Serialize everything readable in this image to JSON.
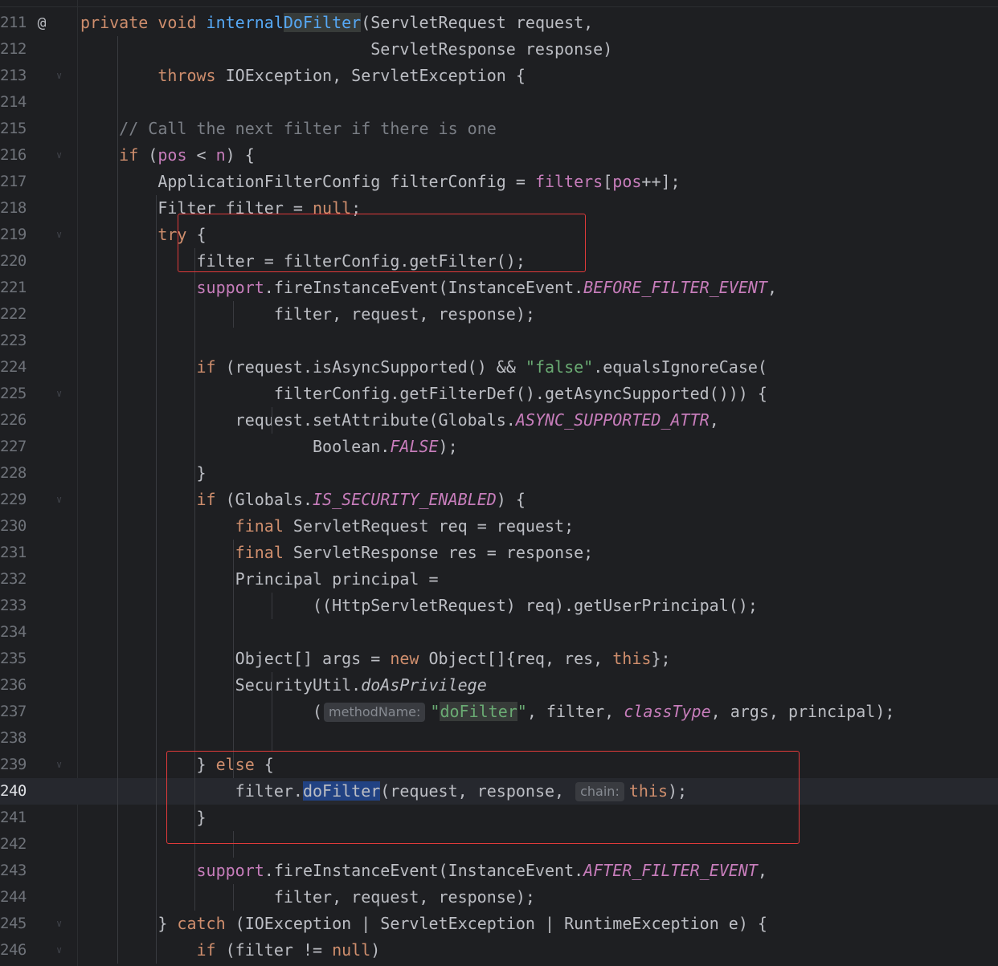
{
  "editor": {
    "current_line": "240",
    "gutter_annotation": "@",
    "lines": [
      {
        "n": "211",
        "code": "<span class=\"k\">private void</span> <span class=\"fn\">internal<span class=\"hl-ident\">DoFilter</span></span>(ServletRequest request,"
      },
      {
        "n": "212",
        "code": "                              ServletResponse response)"
      },
      {
        "n": "213",
        "code": "        <span class=\"k\">throws</span> IOException, ServletException {"
      },
      {
        "n": "214",
        "code": ""
      },
      {
        "n": "215",
        "code": "    <span class=\"c\">// Call the next filter if there is one</span>"
      },
      {
        "n": "216",
        "code": "    <span class=\"k\">if</span> (<span class=\"p\">pos</span> &lt; <span class=\"p\">n</span>) {"
      },
      {
        "n": "217",
        "code": "        ApplicationFilterConfig filterConfig = <span class=\"p\">filters</span>[<span class=\"p\">pos</span>++];"
      },
      {
        "n": "218",
        "code": "        Filter filter = <span class=\"k\">null</span>;"
      },
      {
        "n": "219",
        "code": "        <span class=\"k\">try</span> {"
      },
      {
        "n": "220",
        "code": "            filter = filterConfig.getFilter();"
      },
      {
        "n": "221",
        "code": "            <span class=\"p\">support</span>.fireInstanceEvent(InstanceEvent.<span class=\"pi\">BEFORE_FILTER_EVENT</span>,"
      },
      {
        "n": "222",
        "code": "                    filter, request, response);"
      },
      {
        "n": "223",
        "code": ""
      },
      {
        "n": "224",
        "code": "            <span class=\"k\">if</span> (request.isAsyncSupported() &amp;&amp; <span class=\"s\">\"false\"</span>.equalsIgnoreCase("
      },
      {
        "n": "225",
        "code": "                    filterConfig.getFilterDef().getAsyncSupported())) {"
      },
      {
        "n": "226",
        "code": "                request.setAttribute(Globals.<span class=\"pi\">ASYNC_SUPPORTED_ATTR</span>,"
      },
      {
        "n": "227",
        "code": "                        Boolean.<span class=\"pi\">FALSE</span>);"
      },
      {
        "n": "228",
        "code": "            }"
      },
      {
        "n": "229",
        "code": "            <span class=\"k\">if</span> (Globals.<span class=\"pi\">IS_SECURITY_ENABLED</span>) {"
      },
      {
        "n": "230",
        "code": "                <span class=\"k\">final</span> ServletRequest req = request;"
      },
      {
        "n": "231",
        "code": "                <span class=\"k\">final</span> ServletResponse res = response;"
      },
      {
        "n": "232",
        "code": "                Principal principal ="
      },
      {
        "n": "233",
        "code": "                        ((HttpServletRequest) req).getUserPrincipal();"
      },
      {
        "n": "234",
        "code": ""
      },
      {
        "n": "235",
        "code": "                Object[] args = <span class=\"k\">new</span> Object[]{req, res, <span class=\"k\">this</span>};"
      },
      {
        "n": "236",
        "code": "                SecurityUtil.<span class=\"sm\">doAsPrivilege</span>"
      },
      {
        "n": "237",
        "code": "                        (<span class=\"hint\">methodName:</span><span class=\"s\">\"<span class=\"hl-ident\">doFilter</span>\"</span>, filter, <span class=\"pi\">classType</span>, args, principal);"
      },
      {
        "n": "238",
        "code": ""
      },
      {
        "n": "239",
        "code": "            } <span class=\"k\">else</span> {"
      },
      {
        "n": "240",
        "code": "                filter.<span class=\"hl-sel\">doFilter</span>(request, response, <span class=\"hint\">chain:</span><span class=\"k\">this</span>);"
      },
      {
        "n": "241",
        "code": "            }"
      },
      {
        "n": "242",
        "code": ""
      },
      {
        "n": "243",
        "code": "            <span class=\"p\">support</span>.fireInstanceEvent(InstanceEvent.<span class=\"pi\">AFTER_FILTER_EVENT</span>,"
      },
      {
        "n": "244",
        "code": "                    filter, request, response);"
      },
      {
        "n": "245",
        "code": "        } <span class=\"k\">catch</span> (IOException | ServletException | RuntimeException e) {"
      },
      {
        "n": "246",
        "code": "            <span class=\"k\">if</span> (filter != <span class=\"k\">null</span>)"
      }
    ]
  },
  "colors": {
    "background": "#1e1f22",
    "current_line_bg": "#26282e",
    "keyword": "#cf8e6d",
    "method_declaration": "#56a8f5",
    "field": "#c77dbb",
    "string": "#6aab73",
    "comment": "#7a7e85",
    "selection": "#214283",
    "annotation_box": "#e03a3a"
  }
}
